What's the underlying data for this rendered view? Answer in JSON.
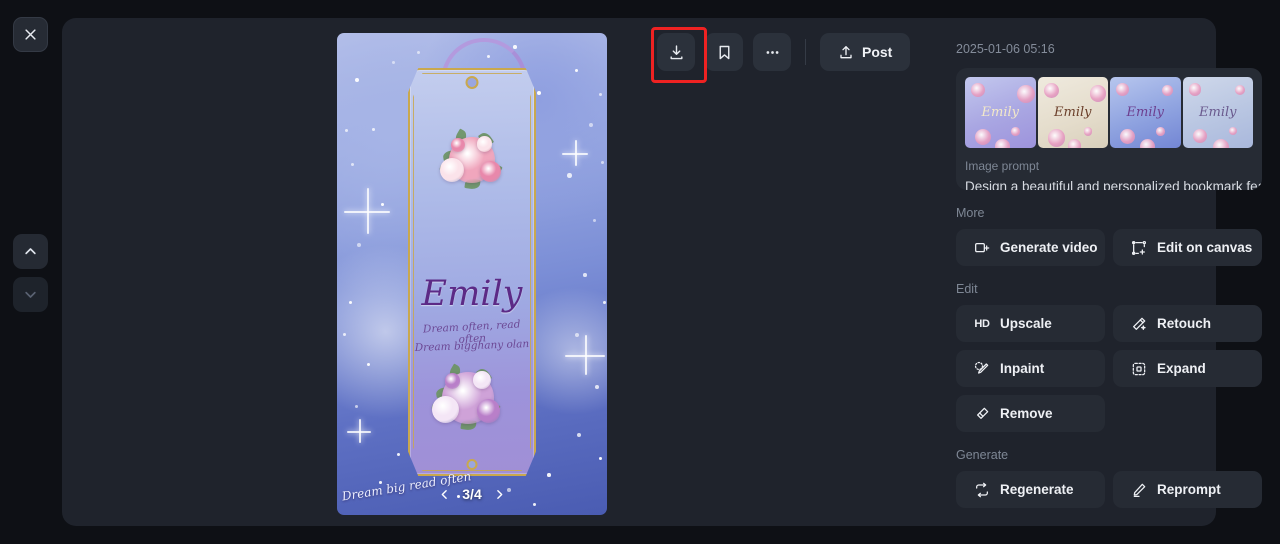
{
  "rail": {
    "close_label": "Close",
    "prev_label": "Previous",
    "next_label": "Next"
  },
  "toolbar": {
    "download_label": "Download",
    "bookmark_label": "Bookmark",
    "more_label": "More options",
    "post_label": "Post"
  },
  "stage": {
    "pagination": "3/4",
    "prev_label": "Previous image",
    "next_label": "Next image",
    "artwork": {
      "name": "Emily",
      "line1": "Dream often, read often",
      "line2": "Dream bigghany olan",
      "caption": "Dream big read often"
    }
  },
  "side": {
    "timestamp": "2025-01-06 05:16",
    "thumbnails": [
      {
        "name": "Emily",
        "variant": "lavender-book"
      },
      {
        "name": "Emily",
        "variant": "cream-frame"
      },
      {
        "name": "Emily",
        "variant": "tassel-bookmark"
      },
      {
        "name": "Emily",
        "variant": "floral-wreath"
      }
    ],
    "prompt_label": "Image prompt",
    "prompt_text": "Design a beautiful and personalized bookmark fea",
    "sections": [
      {
        "title": "More",
        "actions": [
          {
            "label": "Generate video",
            "icon": "video-icon"
          },
          {
            "label": "Edit on canvas",
            "icon": "canvas-icon"
          }
        ]
      },
      {
        "title": "Edit",
        "actions": [
          {
            "label": "Upscale",
            "icon": "hd-icon"
          },
          {
            "label": "Retouch",
            "icon": "wand-icon"
          },
          {
            "label": "Inpaint",
            "icon": "brush-icon"
          },
          {
            "label": "Expand",
            "icon": "expand-icon"
          },
          {
            "label": "Remove",
            "icon": "eraser-icon"
          }
        ]
      },
      {
        "title": "Generate",
        "actions": [
          {
            "label": "Regenerate",
            "icon": "refresh-icon"
          },
          {
            "label": "Reprompt",
            "icon": "pencil-icon"
          }
        ]
      }
    ]
  },
  "colors": {
    "page_bg": "#0e1015",
    "panel_bg": "#1f232c",
    "card_bg": "#262b34",
    "button_bg": "#2b313b",
    "text_primary": "#eef0f4",
    "text_muted": "#7e8795",
    "highlight": "#ef2222"
  }
}
